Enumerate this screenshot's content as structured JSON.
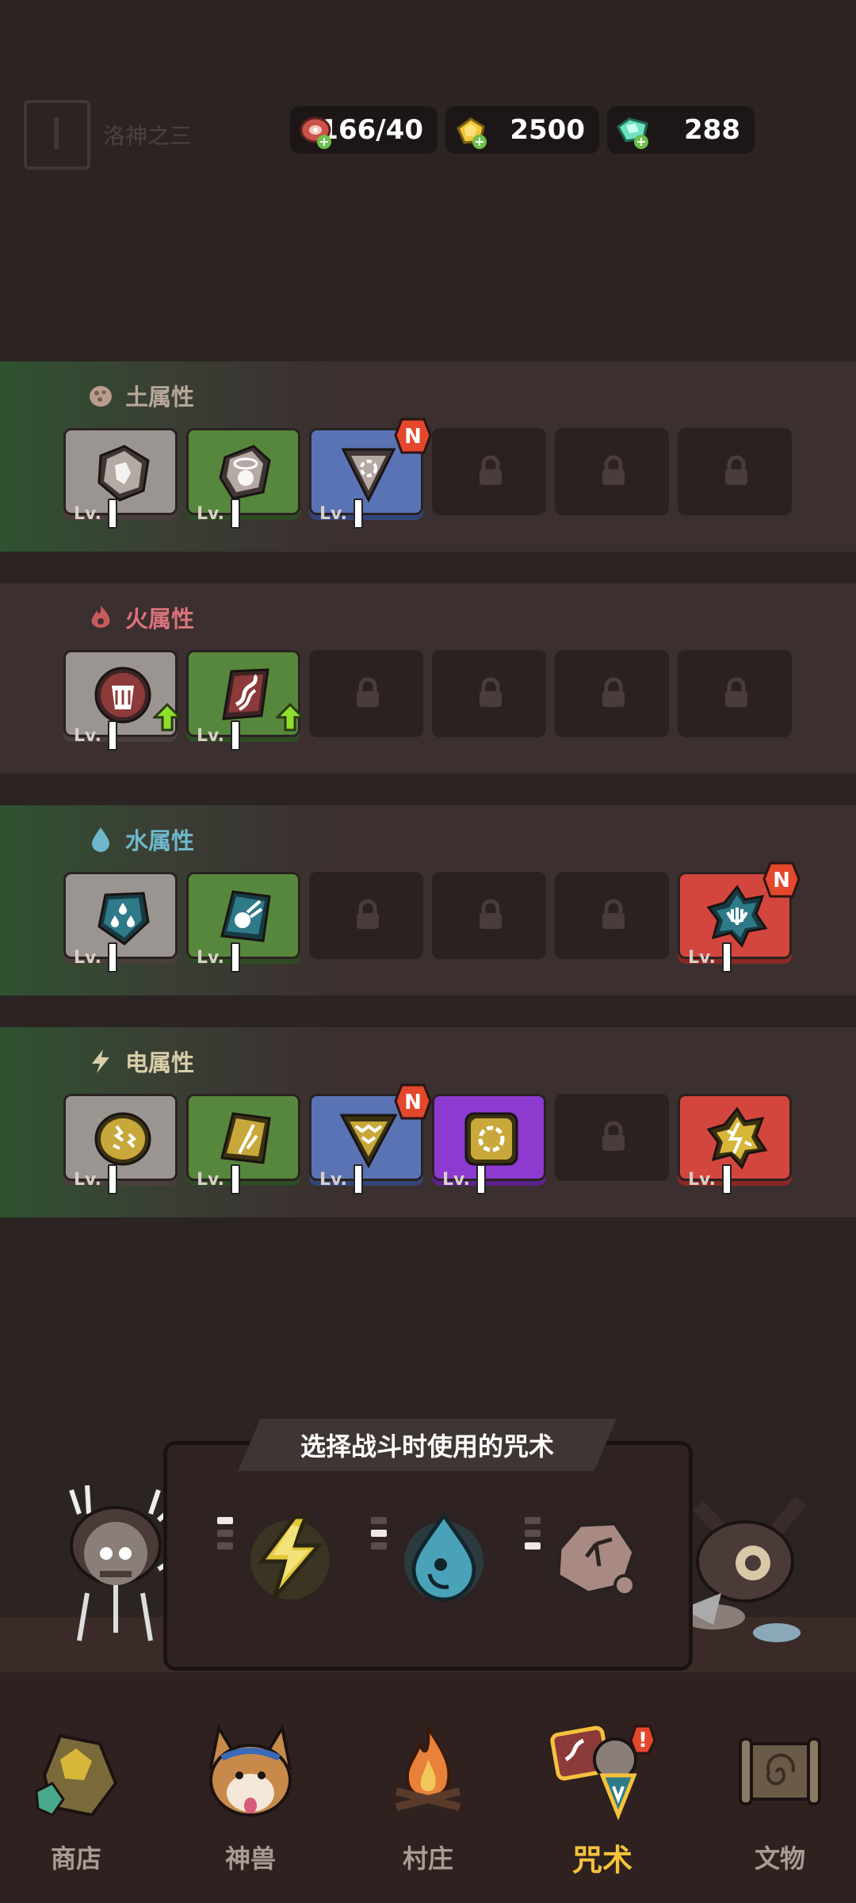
{
  "resources": {
    "meat": "166/40",
    "gold": "2500",
    "gem": "288"
  },
  "faded_header": {
    "text": "洛神之三"
  },
  "sections": [
    {
      "title": "土属性",
      "color": "#b8a89a",
      "slots": [
        {
          "type": "gray",
          "level": "Lv."
        },
        {
          "type": "green",
          "level": "Lv."
        },
        {
          "type": "blue",
          "level": "Lv.",
          "badge": "N"
        },
        {
          "type": "locked"
        },
        {
          "type": "locked"
        },
        {
          "type": "locked"
        }
      ]
    },
    {
      "title": "火属性",
      "color": "#d9737a",
      "slots": [
        {
          "type": "gray",
          "level": "Lv.",
          "upgrade": true
        },
        {
          "type": "green",
          "level": "Lv.",
          "upgrade": true
        },
        {
          "type": "locked"
        },
        {
          "type": "locked"
        },
        {
          "type": "locked"
        },
        {
          "type": "locked"
        }
      ]
    },
    {
      "title": "水属性",
      "color": "#6fb8cc",
      "slots": [
        {
          "type": "gray",
          "level": "Lv."
        },
        {
          "type": "green",
          "level": "Lv."
        },
        {
          "type": "locked"
        },
        {
          "type": "locked"
        },
        {
          "type": "locked"
        },
        {
          "type": "red",
          "level": "Lv.",
          "badge": "N"
        }
      ]
    },
    {
      "title": "电属性",
      "color": "#d8cfa8",
      "slots": [
        {
          "type": "gray",
          "level": "Lv."
        },
        {
          "type": "green",
          "level": "Lv."
        },
        {
          "type": "blue",
          "level": "Lv.",
          "badge": "N"
        },
        {
          "type": "purple",
          "level": "Lv."
        },
        {
          "type": "locked"
        },
        {
          "type": "red",
          "level": "Lv."
        }
      ]
    }
  ],
  "spell_panel": {
    "title": "选择战斗时使用的咒术",
    "spells": [
      "lightning",
      "water",
      "rock"
    ]
  },
  "nav": [
    {
      "label": "商店",
      "icon": "ore-icon"
    },
    {
      "label": "神兽",
      "icon": "corgi-icon"
    },
    {
      "label": "村庄",
      "icon": "campfire-icon"
    },
    {
      "label": "咒术",
      "icon": "spell-cards-icon",
      "active": true
    },
    {
      "label": "文物",
      "icon": "scroll-icon"
    }
  ]
}
